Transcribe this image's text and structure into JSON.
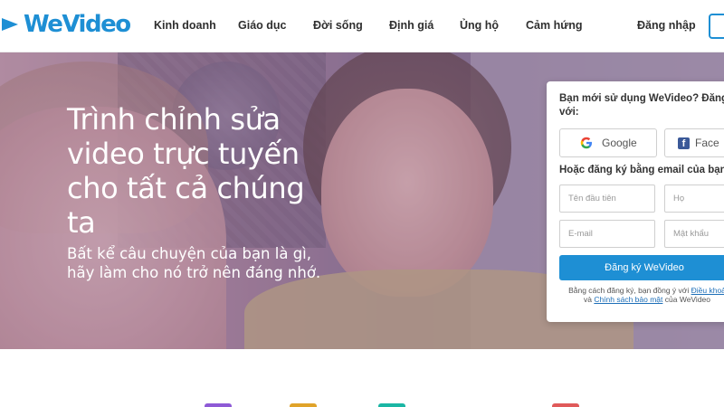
{
  "brand": {
    "name": "WeVideo",
    "color": "#1e8fd4"
  },
  "nav": {
    "items": [
      {
        "label": "Kinh doanh"
      },
      {
        "label": "Giáo dục"
      },
      {
        "label": "Đời sống"
      },
      {
        "label": "Định giá"
      },
      {
        "label": "Ủng hộ"
      },
      {
        "label": "Cảm hứng"
      }
    ],
    "login_label": "Đăng nhập"
  },
  "hero": {
    "title_lines": [
      "Trình chỉnh sửa",
      "video trực tuyến",
      "cho tất cả chúng",
      "ta"
    ],
    "subtitle_lines": [
      "Bất kể câu chuyện của bạn là gì,",
      "hãy làm cho nó trở nên đáng nhớ."
    ]
  },
  "signup": {
    "prompt_lines": [
      "Bạn mới sử dụng WeVideo? Đăng",
      "với:"
    ],
    "google_label": "Google",
    "facebook_label": "Face",
    "email_prompt": "Hoặc đăng ký bằng email của bạn:",
    "first_name_placeholder": "Tên đầu tiên",
    "last_name_placeholder": "Họ",
    "email_placeholder": "E-mail",
    "password_placeholder": "Mật khẩu",
    "submit_label": "Đăng ký WeVideo",
    "terms_line1_prefix": "Bằng cách đăng ký, bạn đồng ý với ",
    "terms_link1": "Điều khoả",
    "terms_line2_prefix": "và ",
    "terms_link2": "Chính sách bảo mật",
    "terms_line2_suffix": " của WeVideo"
  },
  "colors": {
    "accent": "#1e8fd4",
    "facebook": "#3b5998",
    "chips": [
      "#8e5ad6",
      "#e0a32a",
      "#1bb6a4",
      "#e05a5a"
    ]
  }
}
